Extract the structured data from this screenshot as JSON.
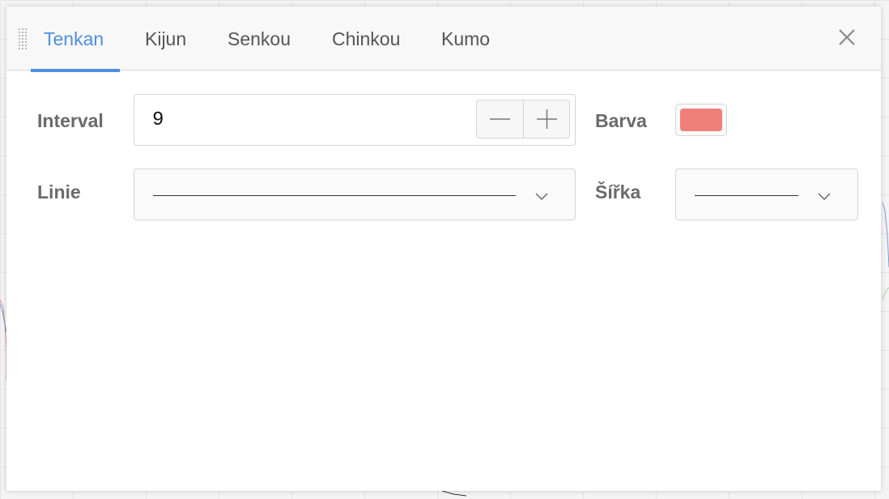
{
  "dialog": {
    "tabs": [
      {
        "label": "Tenkan",
        "active": true
      },
      {
        "label": "Kijun",
        "active": false
      },
      {
        "label": "Senkou",
        "active": false
      },
      {
        "label": "Chinkou",
        "active": false
      },
      {
        "label": "Kumo",
        "active": false
      }
    ],
    "close_icon": "close-icon",
    "drag_icon": "drag-handle-icon"
  },
  "form": {
    "interval": {
      "label": "Interval",
      "value": "9",
      "decrement_icon": "minus-icon",
      "increment_icon": "plus-icon"
    },
    "color": {
      "label": "Barva",
      "value": "#f07f7a"
    },
    "line_style": {
      "label": "Linie",
      "selected": "solid",
      "chevron_icon": "chevron-down-icon"
    },
    "line_width": {
      "label": "Šířka",
      "selected": "thin",
      "chevron_icon": "chevron-down-icon"
    }
  },
  "colors": {
    "accent": "#4f8fde",
    "label": "#6a6a6a",
    "border": "#d4d4d4"
  }
}
